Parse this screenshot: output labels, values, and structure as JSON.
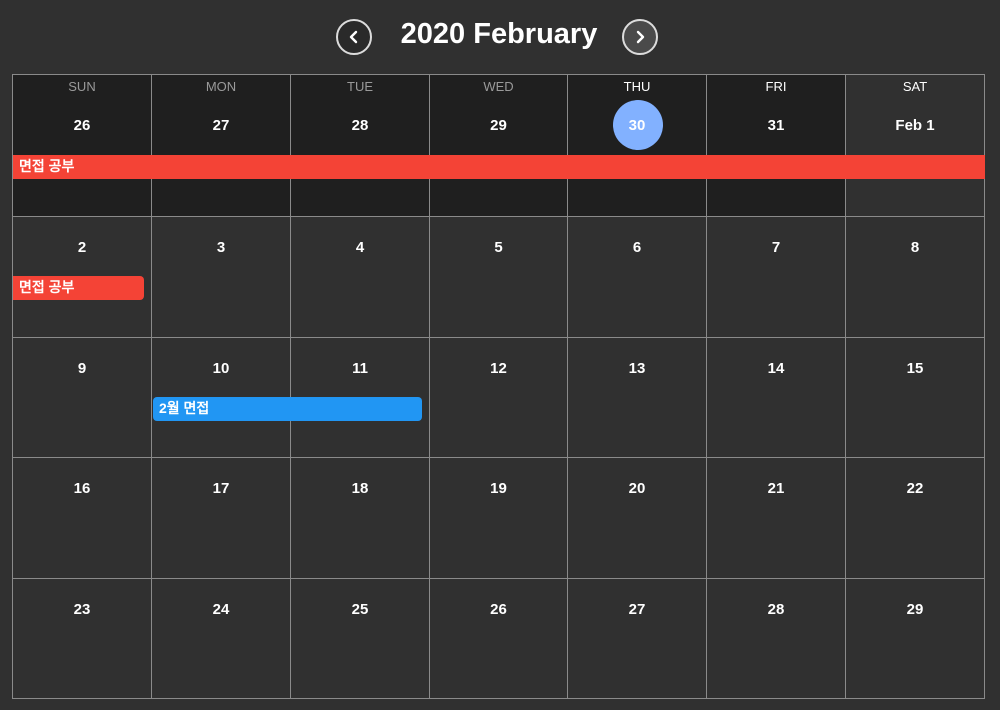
{
  "header": {
    "title": "2020 February",
    "prev_icon": "chevron-left-icon",
    "next_icon": "chevron-right-icon"
  },
  "weekdays": [
    "SUN",
    "MON",
    "TUE",
    "WED",
    "THU",
    "FRI",
    "SAT"
  ],
  "weeks": [
    [
      "26",
      "27",
      "28",
      "29",
      "30",
      "31",
      "Feb 1"
    ],
    [
      "2",
      "3",
      "4",
      "5",
      "6",
      "7",
      "8"
    ],
    [
      "9",
      "10",
      "11",
      "12",
      "13",
      "14",
      "15"
    ],
    [
      "16",
      "17",
      "18",
      "19",
      "20",
      "21",
      "22"
    ],
    [
      "23",
      "24",
      "25",
      "26",
      "27",
      "28",
      "29"
    ]
  ],
  "today": "30",
  "events": [
    {
      "label": "면접 공부",
      "color": "#f44336"
    },
    {
      "label": "면접 공부",
      "color": "#f44336"
    },
    {
      "label": "2월 면접",
      "color": "#2196f3"
    }
  ],
  "colors": {
    "background": "#303030",
    "outside_month_cell": "#1f1f1f",
    "today_highlight": "#82b1ff",
    "grid_line": "#8a8a8a"
  }
}
